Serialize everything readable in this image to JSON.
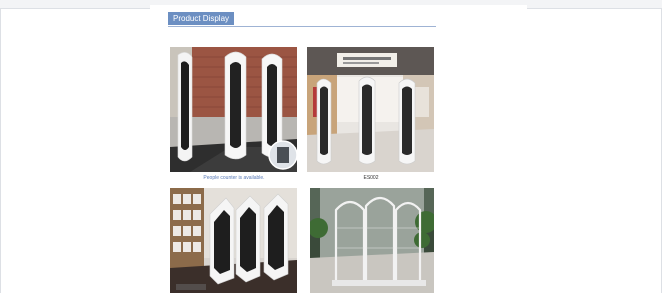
{
  "section": {
    "title": "Product Display"
  },
  "photos": [
    {
      "caption": "People counter is available.",
      "alt_icon": "store-entrance-gates-photo"
    },
    {
      "caption": "ES002",
      "alt_icon": "mall-cosmetics-gates-photo"
    },
    {
      "caption": "",
      "alt_icon": "bookstore-gates-photo"
    },
    {
      "caption": "",
      "alt_icon": "white-arch-gates-photo"
    }
  ],
  "colors": {
    "title_bg": "#6c8fc2",
    "caption_link": "#5a7bb8"
  }
}
